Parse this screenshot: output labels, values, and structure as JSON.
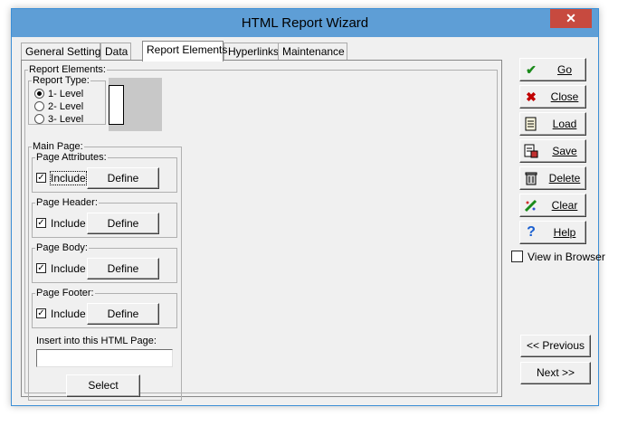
{
  "window": {
    "title": "HTML Report Wizard",
    "close_glyph": "✕"
  },
  "tabs": [
    {
      "label": "General Settings"
    },
    {
      "label": "Data"
    },
    {
      "label": "Report Elements"
    },
    {
      "label": "Hyperlinks"
    },
    {
      "label": "Maintenance"
    }
  ],
  "report_elements": {
    "legend": "Report Elements:",
    "report_type": {
      "legend": "Report Type:",
      "options": [
        "1- Level",
        "2- Level",
        "3- Level"
      ],
      "selected": "1- Level"
    }
  },
  "main_page": {
    "legend": "Main Page:",
    "sections": [
      {
        "legend": "Page Attributes:",
        "include_label": "Include",
        "checked": true,
        "define_label": "Define"
      },
      {
        "legend": "Page Header:",
        "include_label": "Include",
        "checked": true,
        "define_label": "Define"
      },
      {
        "legend": "Page Body:",
        "include_label": "Include",
        "checked": true,
        "define_label": "Define"
      },
      {
        "legend": "Page Footer:",
        "include_label": "Include",
        "checked": true,
        "define_label": "Define"
      }
    ],
    "insert_label": "Insert into this HTML Page:",
    "insert_value": "",
    "select_label": "Select"
  },
  "side_buttons": [
    {
      "label": "Go",
      "icon": "checkmark-icon"
    },
    {
      "label": "Close",
      "icon": "x-icon"
    },
    {
      "label": "Load",
      "icon": "document-icon"
    },
    {
      "label": "Save",
      "icon": "save-document-icon"
    },
    {
      "label": "Delete",
      "icon": "trash-icon"
    },
    {
      "label": "Clear",
      "icon": "eraser-icon"
    },
    {
      "label": "Help",
      "icon": "question-icon"
    }
  ],
  "view_in_browser": {
    "label": "View in Browser",
    "checked": false
  },
  "nav": {
    "previous": "<< Previous",
    "next": "Next >>"
  },
  "colors": {
    "titlebar": "#5e9ed6",
    "close": "#c74a3f",
    "go_icon": "#1a8a1a",
    "close_icon": "#c00000",
    "help_icon": "#1a5fd0"
  }
}
